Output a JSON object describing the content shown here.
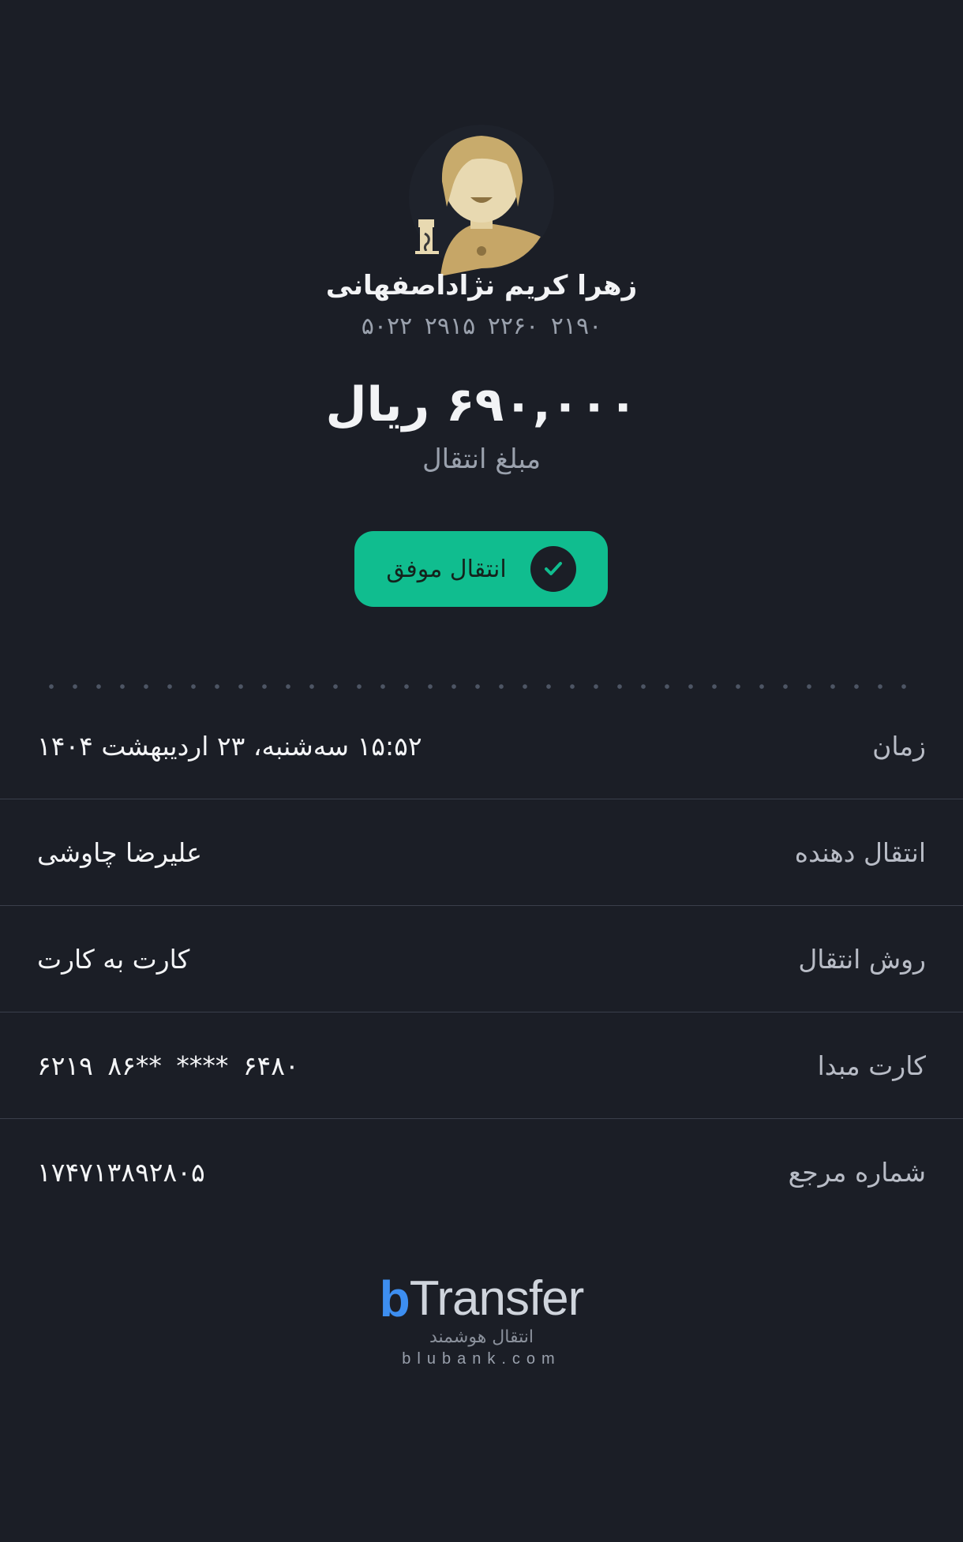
{
  "recipient": {
    "name": "زهرا کریم نژاداصفهانی",
    "card_number": "۵۰۲۲  ۲۹۱۵  ۲۲۶۰  ۲۱۹۰"
  },
  "transfer": {
    "amount": "۶۹۰,۰۰۰ ریال",
    "amount_label": "مبلغ انتقال",
    "status_label": "انتقال موفق"
  },
  "details": {
    "rows": [
      {
        "label": "زمان",
        "value": "۱۵:۵۲ سه‌شنبه، ۲۳ اردیبهشت ۱۴۰۴"
      },
      {
        "label": "انتقال دهنده",
        "value": "علیرضا چاوشی"
      },
      {
        "label": "روش انتقال",
        "value": "کارت به کارت"
      },
      {
        "label": "کارت مبدا",
        "value": "۶۲۱۹  ۸۶** ****  ۶۴۸۰"
      },
      {
        "label": "شماره مرجع",
        "value": "۱۷۴۷۱۳۸۹۲۸۰۵"
      }
    ]
  },
  "footer": {
    "logo_b": "b",
    "logo_text": "Transfer",
    "logo_tagline": "انتقال هوشمند",
    "domain": "blubank.com"
  },
  "colors": {
    "background": "#1b1e26",
    "success": "#10bd8f",
    "brand": "#3d8ef0"
  }
}
